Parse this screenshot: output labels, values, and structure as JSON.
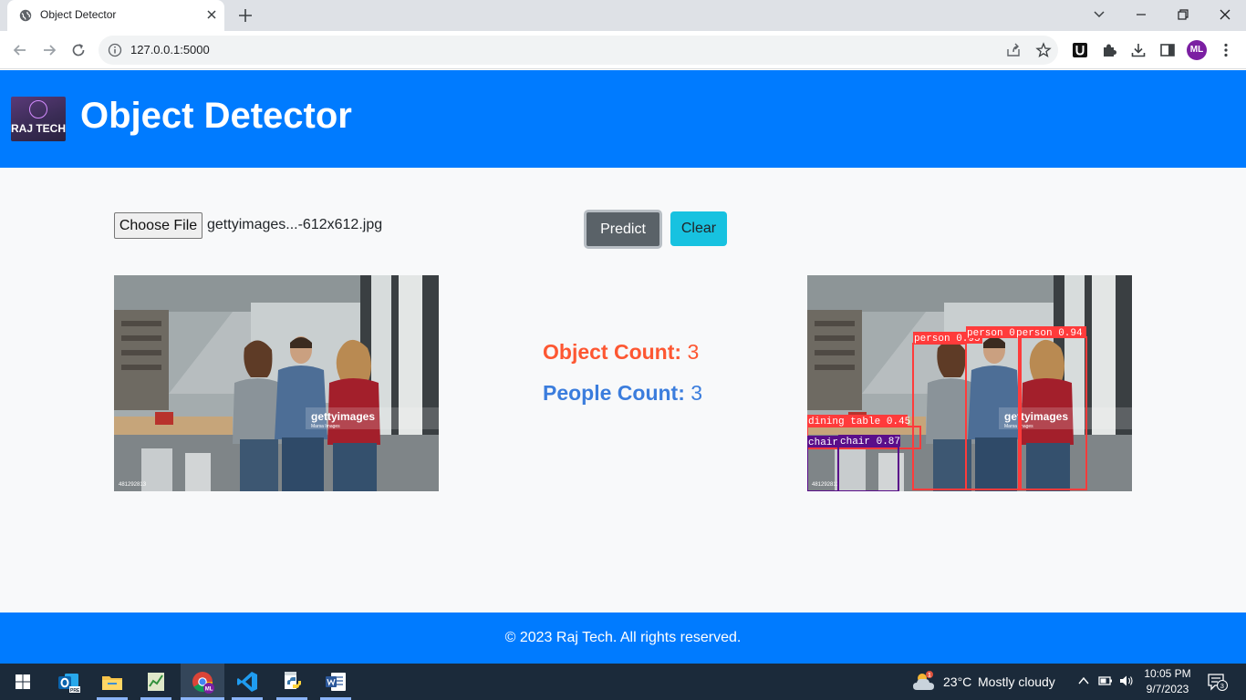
{
  "browser": {
    "tab_title": "Object Detector",
    "url": "127.0.0.1:5000",
    "profile_initials": "ML"
  },
  "header": {
    "logo_text": "RAJ TECH",
    "title": "Object Detector"
  },
  "upload": {
    "choose_label": "Choose File",
    "file_name": "gettyimages...-612x612.jpg",
    "predict_label": "Predict",
    "clear_label": "Clear"
  },
  "images": {
    "watermark": "gettyimages",
    "watermark_sub": "Marsa Images",
    "image_id": "481292813",
    "detections": [
      {
        "label": "person 0.95",
        "color": "#ff3b3b"
      },
      {
        "label": "person 0",
        "color": "#ff3b3b"
      },
      {
        "label": "person 0.94",
        "color": "#ff3b3b"
      },
      {
        "label": "dining table 0.45",
        "color": "#ff3b3b"
      },
      {
        "label": "chair",
        "color": "#5a0e8a"
      },
      {
        "label": "chair 0.87",
        "color": "#5a0e8a"
      }
    ]
  },
  "counts": {
    "object_label": "Object Count:",
    "object_value": "3",
    "people_label": "People Count:",
    "people_value": "3"
  },
  "footer": {
    "text": "© 2023 Raj Tech. All rights reserved."
  },
  "taskbar": {
    "weather_temp": "23°C",
    "weather_desc": "Mostly cloudy",
    "time": "10:05 PM",
    "date": "9/7/2023",
    "notification_count": "3",
    "outlook_badge": "PRE",
    "weather_badge": "1"
  },
  "colors": {
    "brand": "#007bff",
    "object_count": "#fd5732",
    "people_count": "#3b7ddd",
    "predict_button": "#5a6268",
    "clear_button": "#17c2e0"
  }
}
